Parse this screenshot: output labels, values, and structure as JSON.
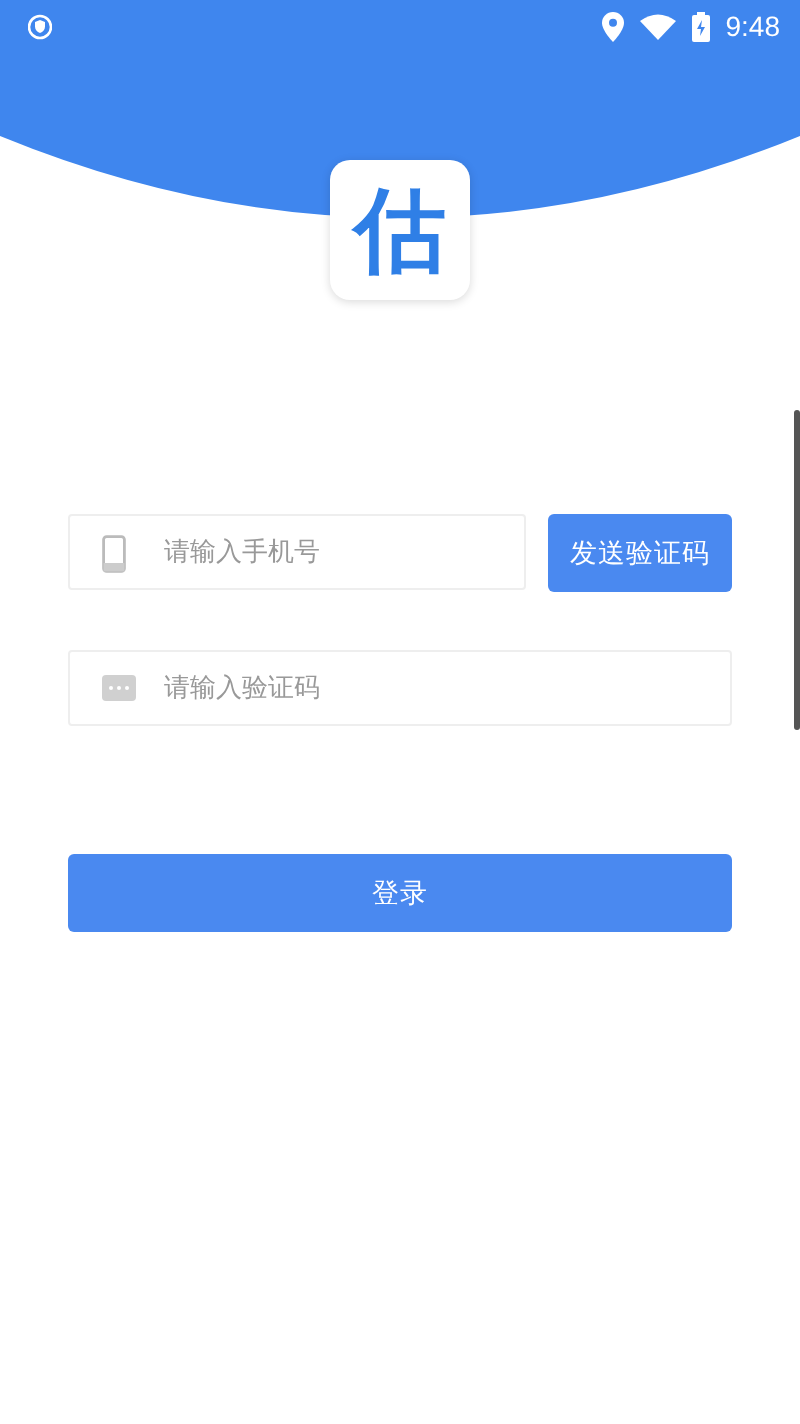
{
  "status_bar": {
    "time": "9:48"
  },
  "logo": {
    "text": "估"
  },
  "phone_field": {
    "placeholder": "请输入手机号"
  },
  "send_code_button": {
    "label": "发送验证码"
  },
  "code_field": {
    "placeholder": "请输入验证码"
  },
  "login_button": {
    "label": "登录"
  }
}
